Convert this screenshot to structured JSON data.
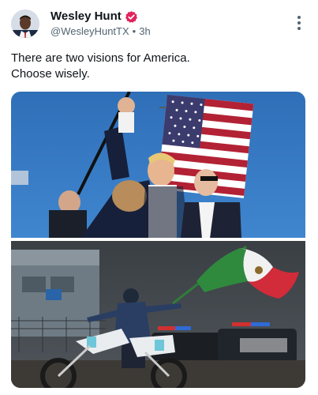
{
  "author": {
    "display_name": "Wesley Hunt",
    "handle": "@WesleyHuntTX",
    "time": "3h",
    "verified_badge": "verified-badge-icon",
    "avatar": "avatar"
  },
  "post": {
    "text_line_1": "There are two visions for America.",
    "text_line_2": "Choose wisely."
  },
  "icons": {
    "more": "more-options-icon"
  },
  "colors": {
    "verified": "#e0245e",
    "secondary_text": "#536471",
    "primary_text": "#0f1419"
  }
}
